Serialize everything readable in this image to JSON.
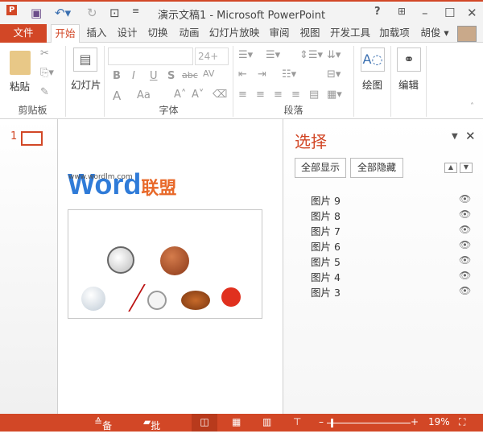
{
  "window": {
    "title": "演示文稿1 - Microsoft PowerPoint",
    "help": "?"
  },
  "tabs": [
    "文件",
    "开始",
    "插入",
    "设计",
    "切换",
    "动画",
    "幻灯片放映",
    "审阅",
    "视图",
    "开发工具",
    "加载项"
  ],
  "user": {
    "name": "胡俊"
  },
  "ribbon": {
    "clipboard": {
      "label": "剪贴板",
      "paste": "粘贴"
    },
    "slides": {
      "new_slide": "幻灯片"
    },
    "font": {
      "label": "字体",
      "size": "24+",
      "bold": "B",
      "italic": "I",
      "underline": "U",
      "shadow": "S",
      "strike": "abc",
      "spacing": "AV",
      "color": "A",
      "case": "Aa"
    },
    "paragraph": {
      "label": "段落"
    },
    "drawing": {
      "label": "绘图"
    },
    "editing": {
      "label": "编辑"
    }
  },
  "thumbs": {
    "slide_number": "1"
  },
  "slide": {
    "watermark_url": "www.wordlm.com",
    "watermark_word": "Word",
    "watermark_cn": "联盟"
  },
  "selection_pane": {
    "title": "选择",
    "show_all": "全部显示",
    "hide_all": "全部隐藏",
    "items": [
      "图片 9",
      "图片 8",
      "图片 7",
      "图片 6",
      "图片 5",
      "图片 4",
      "图片 3"
    ]
  },
  "status": {
    "notes": "备注",
    "comments": "批注",
    "zoom": "19%",
    "zoom_percent": 19
  },
  "colors": {
    "accent": "#d24726"
  }
}
